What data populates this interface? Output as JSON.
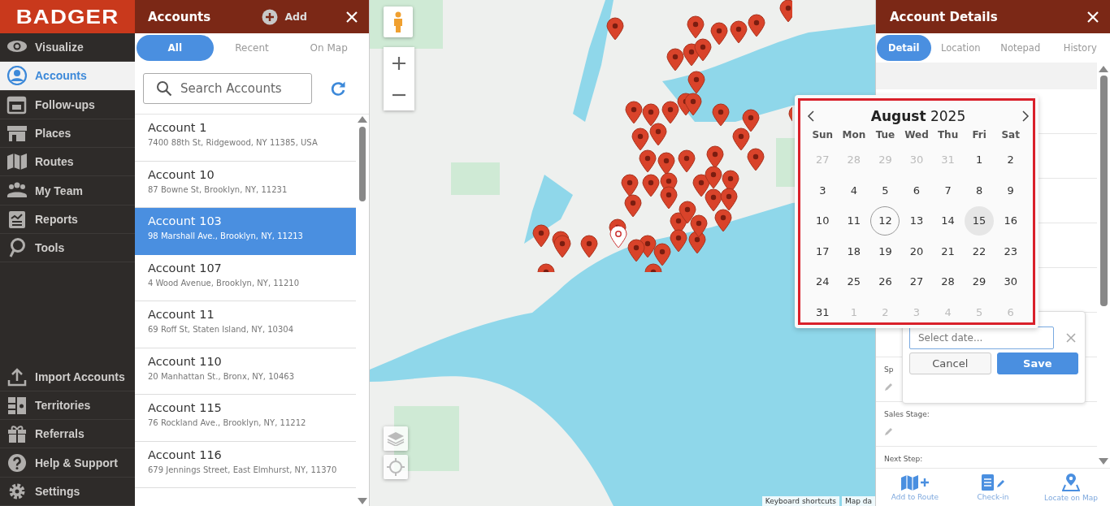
{
  "sidebar": {
    "logo": "BADGER",
    "items": [
      {
        "label": "Visualize",
        "selected": false
      },
      {
        "label": "Accounts",
        "selected": true
      },
      {
        "label": "Follow-ups",
        "selected": false
      },
      {
        "label": "Places",
        "selected": false
      },
      {
        "label": "Routes",
        "selected": false
      },
      {
        "label": "My Team",
        "selected": false
      },
      {
        "label": "Reports",
        "selected": false
      },
      {
        "label": "Tools",
        "selected": false
      }
    ],
    "bottom_items": [
      {
        "label": "Import Accounts",
        "selected": false
      },
      {
        "label": "Territories",
        "selected": false
      },
      {
        "label": "Referrals",
        "selected": false
      },
      {
        "label": "Help & Support",
        "selected": false
      },
      {
        "label": "Settings",
        "selected": false
      }
    ]
  },
  "accounts": {
    "title": "Accounts",
    "add_label": "Add",
    "tabs": [
      {
        "label": "All",
        "selected": true
      },
      {
        "label": "Recent",
        "selected": false
      },
      {
        "label": "On Map",
        "selected": false
      }
    ],
    "search": {
      "placeholder": "Search Accounts"
    },
    "rows": [
      {
        "name": "Account 1",
        "address": "7400 88th St, Ridgewood, NY 11385, USA",
        "selected": false
      },
      {
        "name": "Account 10",
        "address": "87 Bowne St, Brooklyn, NY, 11231",
        "selected": false
      },
      {
        "name": "Account 103",
        "address": "98 Marshall Ave., Brooklyn, NY, 11213",
        "selected": true
      },
      {
        "name": "Account 107",
        "address": "4 Wood Avenue, Brooklyn, NY, 11210",
        "selected": false
      },
      {
        "name": "Account 11",
        "address": "69 Roff St, Staten Island, NY, 10304",
        "selected": false
      },
      {
        "name": "Account 110",
        "address": "20 Manhattan St., Bronx, NY, 10463",
        "selected": false
      },
      {
        "name": "Account 115",
        "address": "76 Rockland Ave., Brooklyn, NY, 11212",
        "selected": false
      },
      {
        "name": "Account 116",
        "address": "679 Jennings Street, East Elmhurst, NY, 11370",
        "selected": false
      }
    ]
  },
  "map": {
    "attribution": [
      "Keyboard shortcuts",
      "Map da"
    ]
  },
  "details": {
    "title": "Account Details",
    "tabs": [
      {
        "label": "Detail",
        "selected": true
      },
      {
        "label": "Location",
        "selected": false
      },
      {
        "label": "Notepad",
        "selected": false
      },
      {
        "label": "History",
        "selected": false
      }
    ],
    "fields": [
      {
        "label": "Sp"
      },
      {
        "label": "Sales Stage:"
      },
      {
        "label": "Next Step:"
      }
    ],
    "toolbar": [
      "Add to Route",
      "Check-in",
      "Locate on Map"
    ]
  },
  "date_picker": {
    "month": "August",
    "year": "2025",
    "weekdays": [
      "Sun",
      "Mon",
      "Tue",
      "Wed",
      "Thu",
      "Fri",
      "Sat"
    ],
    "weeks": [
      [
        {
          "day": "27",
          "outside": true,
          "today": false,
          "selected": false
        },
        {
          "day": "28",
          "outside": true,
          "today": false,
          "selected": false
        },
        {
          "day": "29",
          "outside": true,
          "today": false,
          "selected": false
        },
        {
          "day": "30",
          "outside": true,
          "today": false,
          "selected": false
        },
        {
          "day": "31",
          "outside": true,
          "today": false,
          "selected": false
        },
        {
          "day": "1",
          "outside": false,
          "today": false,
          "selected": false
        },
        {
          "day": "2",
          "outside": false,
          "today": false,
          "selected": false
        }
      ],
      [
        {
          "day": "3",
          "outside": false,
          "today": false,
          "selected": false
        },
        {
          "day": "4",
          "outside": false,
          "today": false,
          "selected": false
        },
        {
          "day": "5",
          "outside": false,
          "today": false,
          "selected": false
        },
        {
          "day": "6",
          "outside": false,
          "today": false,
          "selected": false
        },
        {
          "day": "7",
          "outside": false,
          "today": false,
          "selected": false
        },
        {
          "day": "8",
          "outside": false,
          "today": false,
          "selected": false
        },
        {
          "day": "9",
          "outside": false,
          "today": false,
          "selected": false
        }
      ],
      [
        {
          "day": "10",
          "outside": false,
          "today": false,
          "selected": false
        },
        {
          "day": "11",
          "outside": false,
          "today": false,
          "selected": false
        },
        {
          "day": "12",
          "outside": false,
          "today": true,
          "selected": false
        },
        {
          "day": "13",
          "outside": false,
          "today": false,
          "selected": false
        },
        {
          "day": "14",
          "outside": false,
          "today": false,
          "selected": false
        },
        {
          "day": "15",
          "outside": false,
          "today": false,
          "selected": true
        },
        {
          "day": "16",
          "outside": false,
          "today": false,
          "selected": false
        }
      ],
      [
        {
          "day": "17",
          "outside": false,
          "today": false,
          "selected": false
        },
        {
          "day": "18",
          "outside": false,
          "today": false,
          "selected": false
        },
        {
          "day": "19",
          "outside": false,
          "today": false,
          "selected": false
        },
        {
          "day": "20",
          "outside": false,
          "today": false,
          "selected": false
        },
        {
          "day": "21",
          "outside": false,
          "today": false,
          "selected": false
        },
        {
          "day": "22",
          "outside": false,
          "today": false,
          "selected": false
        },
        {
          "day": "23",
          "outside": false,
          "today": false,
          "selected": false
        }
      ],
      [
        {
          "day": "24",
          "outside": false,
          "today": false,
          "selected": false
        },
        {
          "day": "25",
          "outside": false,
          "today": false,
          "selected": false
        },
        {
          "day": "26",
          "outside": false,
          "today": false,
          "selected": false
        },
        {
          "day": "27",
          "outside": false,
          "today": false,
          "selected": false
        },
        {
          "day": "28",
          "outside": false,
          "today": false,
          "selected": false
        },
        {
          "day": "29",
          "outside": false,
          "today": false,
          "selected": false
        },
        {
          "day": "30",
          "outside": false,
          "today": false,
          "selected": false
        }
      ],
      [
        {
          "day": "31",
          "outside": false,
          "today": false,
          "selected": false
        },
        {
          "day": "1",
          "outside": true,
          "today": false,
          "selected": false
        },
        {
          "day": "2",
          "outside": true,
          "today": false,
          "selected": false
        },
        {
          "day": "3",
          "outside": true,
          "today": false,
          "selected": false
        },
        {
          "day": "4",
          "outside": true,
          "today": false,
          "selected": false
        },
        {
          "day": "5",
          "outside": true,
          "today": false,
          "selected": false
        },
        {
          "day": "6",
          "outside": true,
          "today": false,
          "selected": false
        }
      ]
    ],
    "input": {
      "placeholder": "Select date..."
    },
    "buttons": [
      "Cancel",
      "Save"
    ]
  }
}
